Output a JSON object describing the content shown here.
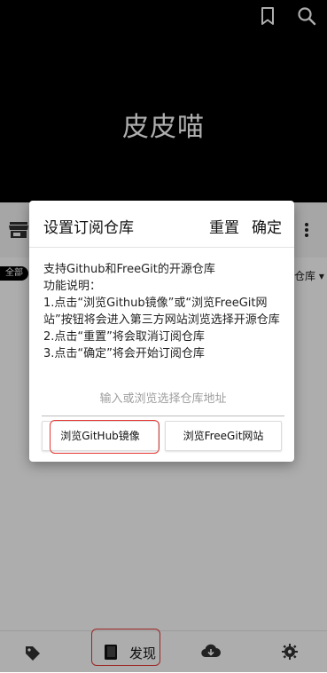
{
  "app": {
    "title": "皮皮喵",
    "filter_chip": "全部",
    "repo_dropdown": "仓库 ▾"
  },
  "dialog": {
    "title": "设置订阅仓库",
    "reset_label": "重置",
    "confirm_label": "确定",
    "description_lines": [
      "支持Github和FreeGit的开源仓库",
      "功能说明：",
      "1.点击“浏览Github镜像”或“浏览FreeGit网站”按钮将会进入第三方网站浏览选择开源仓库",
      "2.点击“重置”将会取消订阅仓库",
      "3.点击“确定”将会开始订阅仓库"
    ],
    "input_placeholder": "输入或浏览选择仓库地址",
    "input_value": "",
    "btn_github": "浏览GitHub镜像",
    "btn_freegit": "浏览FreeGit网站"
  },
  "bottom_nav": {
    "discover_label": "发现",
    "icons": [
      "tag-icon",
      "book-icon",
      "cloud-download-icon",
      "gear-icon"
    ]
  },
  "colors": {
    "header_bg": "#000000",
    "highlight": "#e53935"
  }
}
